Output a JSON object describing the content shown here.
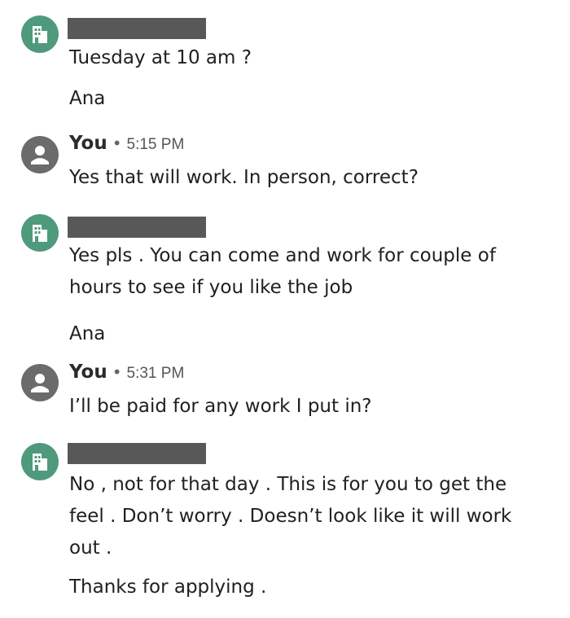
{
  "messages": [
    {
      "sender_type": "company",
      "sender_name_redacted": true,
      "paragraphs": [
        "Tuesday at 10 am ?",
        "Ana"
      ]
    },
    {
      "sender_type": "user",
      "sender_label": "You",
      "time": "5:15 PM",
      "paragraphs": [
        "Yes that will work. In person, correct?"
      ]
    },
    {
      "sender_type": "company",
      "sender_name_redacted": true,
      "paragraphs": [
        [
          "Yes pls . You can come and work for couple of",
          "hours to see if you like the job"
        ],
        "Ana"
      ]
    },
    {
      "sender_type": "user",
      "sender_label": "You",
      "time": "5:31 PM",
      "paragraphs": [
        "I’ll be paid for any work I put in?"
      ]
    },
    {
      "sender_type": "company",
      "sender_name_redacted": true,
      "paragraphs": [
        [
          "No , not for that day . This is for you to get the",
          "feel . Don’t worry . Doesn’t look like it will work",
          "out ."
        ],
        "Thanks for applying ."
      ]
    }
  ],
  "separator": "•",
  "icons": {
    "company_avatar": "building-icon",
    "user_avatar": "person-icon"
  },
  "colors": {
    "company_avatar": "#4f9a7c",
    "user_avatar": "#6b6b6b",
    "redaction_bar": "#585858"
  }
}
